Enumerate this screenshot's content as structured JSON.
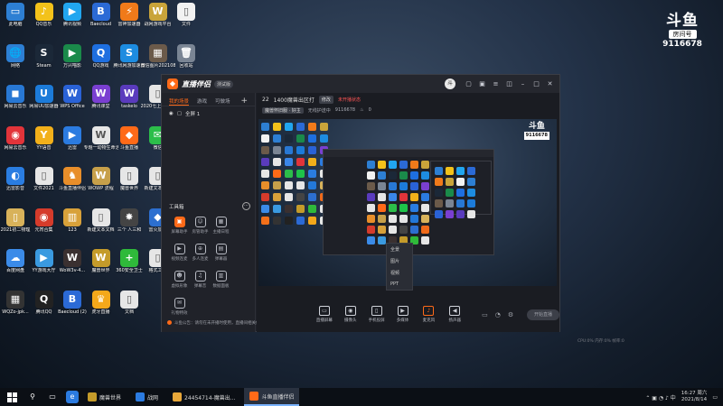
{
  "desktop_icons": [
    {
      "label": "此电脑",
      "bg": "#2d7fd3",
      "glyph": "▭"
    },
    {
      "label": "QQ音乐",
      "bg": "#f3c21a",
      "glyph": "♪"
    },
    {
      "label": "腾讯视频",
      "bg": "#21a6f0",
      "glyph": "▶"
    },
    {
      "label": "Baecloud",
      "bg": "#2b6ad6",
      "glyph": "B"
    },
    {
      "label": "雷神加速器",
      "bg": "#f07a1a",
      "glyph": "⚡"
    },
    {
      "label": "战网游戏平台",
      "bg": "#c9a43a",
      "glyph": "W"
    },
    {
      "label": "文件",
      "bg": "#f2f2f2",
      "glyph": "▯"
    },
    {
      "label": "网络",
      "bg": "#2d7fd3",
      "glyph": "🌐"
    },
    {
      "label": "Steam",
      "bg": "#1b2838",
      "glyph": "S"
    },
    {
      "label": "万兴喵影",
      "bg": "#1a8a4a",
      "glyph": "▶"
    },
    {
      "label": "QQ游戏",
      "bg": "#1e6fe0",
      "glyph": "Q"
    },
    {
      "label": "腾讯网游加速器",
      "bg": "#1d8ce0",
      "glyph": "S"
    },
    {
      "label": "微信图片2021081...",
      "bg": "#6b5a4a",
      "glyph": "▦"
    },
    {
      "label": "回收站",
      "bg": "#7a8594",
      "glyph": "🗑"
    },
    {
      "label": "网易云音乐",
      "bg": "#2878d4",
      "glyph": "◼"
    },
    {
      "label": "网易UU加速器",
      "bg": "#1c7bd9",
      "glyph": "U"
    },
    {
      "label": "WPS Office",
      "bg": "#2a62d6",
      "glyph": "W"
    },
    {
      "label": "腾讯课堂",
      "bg": "#7a3fd1",
      "glyph": "W"
    },
    {
      "label": "taskelo",
      "bg": "#5a3bbd",
      "glyph": "W"
    },
    {
      "label": "2020七上期中生物",
      "bg": "#e6e6e6",
      "glyph": "▯"
    },
    {
      "label": "暴雪战网",
      "bg": "#3a86e8",
      "glyph": "✦"
    },
    {
      "label": "网易云音乐",
      "bg": "#e2343a",
      "glyph": "◉"
    },
    {
      "label": "YY语音",
      "bg": "#f2b01a",
      "glyph": "Y"
    },
    {
      "label": "迅雷",
      "bg": "#2b7be0",
      "glyph": "▶"
    },
    {
      "label": "专题一动物生命活动的主要调节",
      "bg": "#e6e6e6",
      "glyph": "W"
    },
    {
      "label": "斗鱼直播",
      "bg": "#ff6a18",
      "glyph": "◆"
    },
    {
      "label": "微信",
      "bg": "#2cbe4a",
      "glyph": "✉"
    },
    {
      "label": "爱奇艺",
      "bg": "#1ec449",
      "glyph": "iQ"
    },
    {
      "label": "迅雷影音",
      "bg": "#2a7de1",
      "glyph": "◐"
    },
    {
      "label": "文件2021",
      "bg": "#e6e6e6",
      "glyph": "▯"
    },
    {
      "label": "斗鱼直播伴侣",
      "bg": "#e88e2a",
      "glyph": "♞"
    },
    {
      "label": "WOWP 流程",
      "bg": "#c7a04a",
      "glyph": "W"
    },
    {
      "label": "魔兽世界",
      "bg": "#e6e6e6",
      "glyph": "▯"
    },
    {
      "label": "新建文本文档",
      "bg": "#e6e6e6",
      "glyph": "▯"
    },
    {
      "label": "鸿蒙",
      "bg": "#2378d8",
      "glyph": "🌐"
    },
    {
      "label": "2021初二物理",
      "bg": "#d8b25a",
      "glyph": "▯"
    },
    {
      "label": "元宵合集",
      "bg": "#d53b2b",
      "glyph": "◉"
    },
    {
      "label": "123",
      "bg": "#d8a13a",
      "glyph": "▥"
    },
    {
      "label": "新建文本文档",
      "bg": "#e6e6e6",
      "glyph": "▯"
    },
    {
      "label": "三个 人三和",
      "bg": "#444",
      "glyph": "✸"
    },
    {
      "label": "雷火加速",
      "bg": "#2c6fd0",
      "glyph": "◆"
    },
    {
      "label": "向日葵",
      "bg": "#f06a1a",
      "glyph": "✿"
    },
    {
      "label": "百度网盘",
      "bg": "#3b8be8",
      "glyph": "☁"
    },
    {
      "label": "YY游戏大厅",
      "bg": "#3a9ae0",
      "glyph": "▶"
    },
    {
      "label": "WoW3v-4...",
      "bg": "#3a3030",
      "glyph": "W"
    },
    {
      "label": "魔兽世界",
      "bg": "#c49b2a",
      "glyph": "W"
    },
    {
      "label": "360安全卫士",
      "bg": "#2fba3a",
      "glyph": "+"
    },
    {
      "label": "格式工厂",
      "bg": "#e6e6e6",
      "glyph": "▯"
    },
    {
      "label": "Firefox",
      "bg": "#f2701a",
      "glyph": "◉"
    },
    {
      "label": "WQZo-jpk...",
      "bg": "#333",
      "glyph": "▦"
    },
    {
      "label": "腾讯QQ",
      "bg": "#222",
      "glyph": "Q"
    },
    {
      "label": "Baecloud (2)",
      "bg": "#2b6ad6",
      "glyph": "B"
    },
    {
      "label": "虎牙直播",
      "bg": "#f4a81a",
      "glyph": "♛"
    },
    {
      "label": "文档",
      "bg": "#e6e6e6",
      "glyph": "▯"
    }
  ],
  "watermark": {
    "logo": "斗鱼",
    "sub": "房间号",
    "room": "9116678"
  },
  "window": {
    "title": "直播伴侣",
    "beta": "测试版",
    "avatar": "斗",
    "tabs": [
      "我的场景",
      "游戏",
      "可做场"
    ],
    "tab_add": "+",
    "scene": "全屏 1",
    "tools_heading": "工具箱",
    "tools_more": "⋯",
    "tools": [
      {
        "label": "屏幕助手",
        "glyph": "▣",
        "hot": true
      },
      {
        "label": "房管助手",
        "glyph": "☺",
        "hot": false
      },
      {
        "label": "主播日程",
        "glyph": "▦",
        "hot": false
      },
      {
        "label": "",
        "glyph": "",
        "hot": false
      },
      {
        "label": "视频连麦",
        "glyph": "▶",
        "hot": false
      },
      {
        "label": "多人连麦",
        "glyph": "⊕",
        "hot": false
      },
      {
        "label": "弹幕器",
        "glyph": "▤",
        "hot": false
      },
      {
        "label": "",
        "glyph": "",
        "hot": false
      },
      {
        "label": "虚拟形象",
        "glyph": "☻",
        "hot": false
      },
      {
        "label": "弹幕音",
        "glyph": "♫",
        "hot": false
      },
      {
        "label": "数据面板",
        "glyph": "▥",
        "hot": false
      },
      {
        "label": "",
        "glyph": "",
        "hot": false
      },
      {
        "label": "礼物特效",
        "glyph": "✉",
        "hot": false
      },
      {
        "label": "",
        "glyph": "",
        "hot": false
      },
      {
        "label": "",
        "glyph": "",
        "hot": false
      },
      {
        "label": "",
        "glyph": "",
        "hot": false
      }
    ],
    "notice": "斗鱼公告：请勿在未开播时使用，直播间相关信息，更多>",
    "room_bar": {
      "id": "22",
      "name": "1400魔兽出区打",
      "tag": "修改",
      "red": "未开播状态"
    },
    "room_info": {
      "tag": "魔兽怀旧服 · 好主",
      "links": "无线护送中",
      "room": "9116678",
      "heat": "0"
    },
    "context_menu": [
      "全景",
      "图片",
      "视频",
      "PPT"
    ],
    "toolbar": [
      {
        "label": "直播屏幕",
        "glyph": "▭"
      },
      {
        "label": "摄像头",
        "glyph": "◉"
      },
      {
        "label": "手机投屏",
        "glyph": "▯"
      },
      {
        "label": "多媒体",
        "glyph": "▶"
      },
      {
        "label": "麦克风",
        "glyph": "♪",
        "mic": true
      },
      {
        "label": "扬声器",
        "glyph": "◀"
      }
    ],
    "extra_icons": [
      "▭",
      "◔",
      "⚙"
    ],
    "live_button": "开始直播",
    "status": "CPU:0% 内存:0% 帧率:0"
  },
  "taskbar": {
    "tasks": [
      {
        "label": "魔兽世界",
        "color": "#c49b2a",
        "active": false
      },
      {
        "label": "战网",
        "color": "#2b7be0",
        "active": false
      },
      {
        "label": "24454714-魔兽出...",
        "color": "#e8a83a",
        "active": false
      },
      {
        "label": "斗鱼直播伴侣",
        "color": "#ff6a18",
        "active": true
      }
    ],
    "tray_icons": "⌃ ▣ ◔ ♪ 中",
    "time": "16:27 周六",
    "date": "2021/8/14"
  }
}
